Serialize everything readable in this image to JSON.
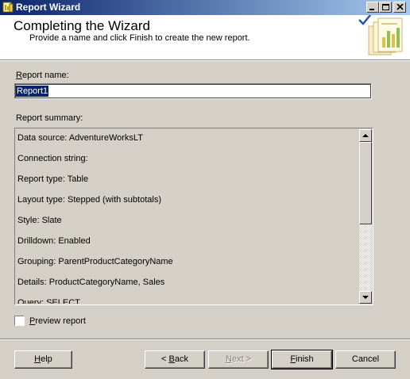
{
  "window": {
    "title": "Report Wizard",
    "controls": [
      "minimize",
      "maximize",
      "close"
    ]
  },
  "header": {
    "heading": "Completing the Wizard",
    "subheading": "Provide a name and click Finish to create the new report."
  },
  "report_name": {
    "label_accel": "R",
    "label_rest": "eport name:",
    "value": "Report1"
  },
  "summary": {
    "label": "Report summary:",
    "lines": [
      "Data source: AdventureWorksLT",
      "Connection string:",
      "Report type: Table",
      "Layout type: Stepped (with subtotals)",
      "Style: Slate",
      "Drilldown: Enabled",
      "Grouping: ParentProductCategoryName",
      "Details: ProductCategoryName, Sales",
      "Query:  SELECT"
    ]
  },
  "preview": {
    "label_accel": "P",
    "label_rest": "review report",
    "checked": false
  },
  "buttons": {
    "help_accel": "H",
    "help_rest": "elp",
    "back_pre": "< ",
    "back_accel": "B",
    "back_rest": "ack",
    "next_pre": "",
    "next_accel": "N",
    "next_rest": "ext >",
    "finish_accel": "F",
    "finish_rest": "inish",
    "cancel": "Cancel"
  },
  "colors": {
    "title_bar_start": "#0a246a",
    "title_bar_end": "#a6caf0",
    "face": "#d4d0c8",
    "selection": "#0a246a"
  }
}
